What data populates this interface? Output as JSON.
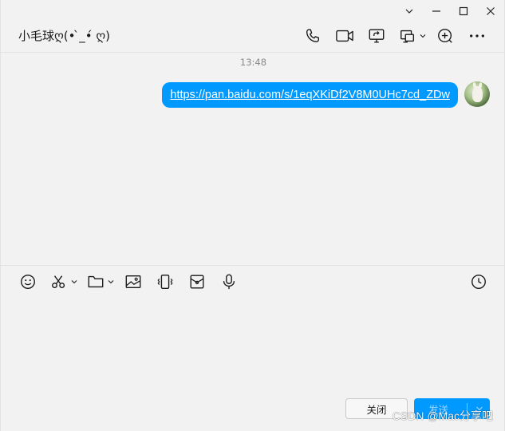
{
  "window": {
    "controls": [
      "chevron-down",
      "minimize",
      "maximize",
      "close"
    ]
  },
  "header": {
    "contact_name": "小毛球ღ(• ̀_•́ ღ)",
    "tools": [
      "phone-icon",
      "video-camera-icon",
      "screen-share-icon",
      "remote-assist-icon",
      "add-icon",
      "more-icon"
    ]
  },
  "messages": {
    "timestamp": "13:48",
    "items": [
      {
        "sender": "me",
        "text": "https://pan.baidu.com/s/1eqXKiDf2V8M0UHc7cd_ZDw"
      }
    ]
  },
  "input_toolbar": {
    "tools": [
      "emoji-icon",
      "screenshot-scissors-icon",
      "folder-icon",
      "image-icon",
      "shake-icon",
      "red-packet-icon",
      "voice-microphone-icon"
    ],
    "history": "clock-icon"
  },
  "input": {
    "value": "",
    "placeholder": ""
  },
  "buttons": {
    "close_label": "关闭",
    "send_label": "发送"
  },
  "watermark": "CSDN @Mac分享吧",
  "colors": {
    "accent": "#0099ff",
    "background": "#f2f2f2",
    "send_text_disabled": "#9fd4ff"
  }
}
